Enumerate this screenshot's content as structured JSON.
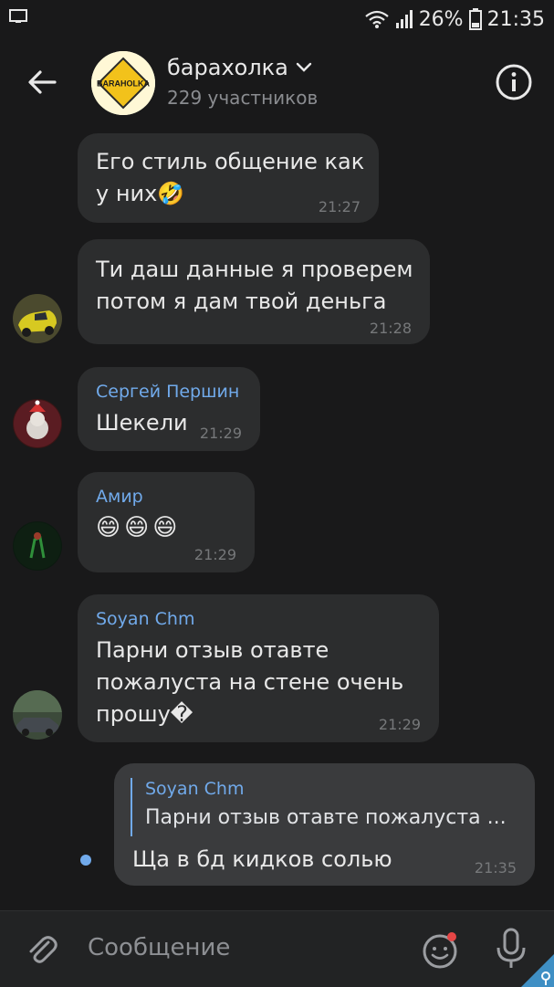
{
  "status_bar": {
    "battery": "26%",
    "time": "21:35"
  },
  "header": {
    "title": "барахолка",
    "subtitle": "229 участников",
    "avatar_text": "BARAHOLKA"
  },
  "messages": [
    {
      "text": "Его стиль общение как\nу них🤣",
      "time": "21:27"
    },
    {
      "text": "Ти даш данные я проверем\nпотом я дам твой деньга",
      "time": "21:28"
    },
    {
      "sender": "Сергей Першин",
      "text": "Шекели",
      "time": "21:29"
    },
    {
      "sender": "Амир",
      "text": "😄😄😄",
      "time": "21:29"
    },
    {
      "sender": "Soyan Chm",
      "text": "Парни отзыв отавте\nпожалуста на стене очень\nпрошу�",
      "time": "21:29"
    }
  ],
  "own_message": {
    "reply_sender": "Soyan Chm",
    "reply_text": "Парни отзыв отавте пожалуста ...",
    "text": "Ща в бд кидков солью",
    "time": "21:35"
  },
  "composer": {
    "placeholder": "Сообщение"
  },
  "colors": {
    "background": "#19191a",
    "bubble": "#2c2d2e",
    "accent": "#71aaeb"
  }
}
